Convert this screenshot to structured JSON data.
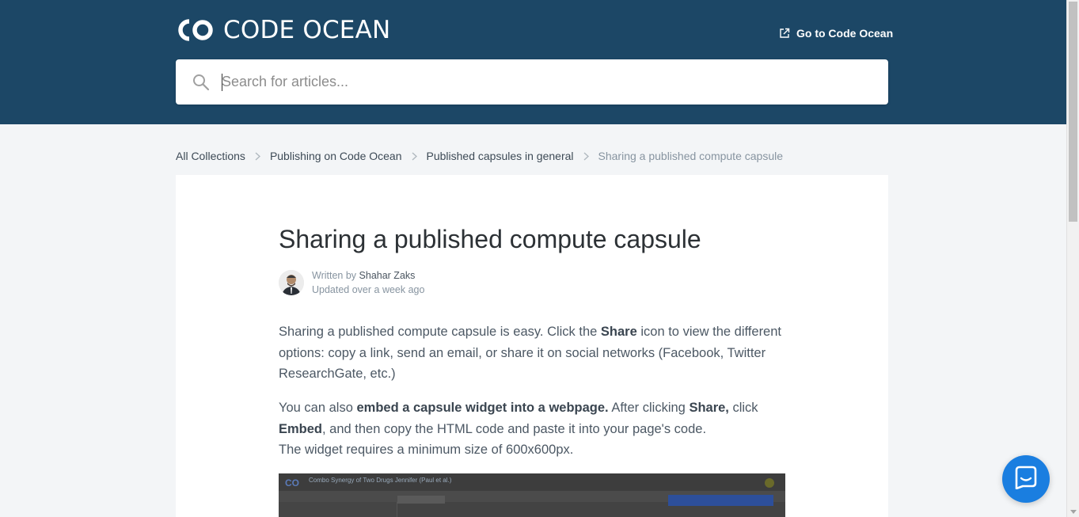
{
  "header": {
    "brand": "CODE OCEAN",
    "goto_label": "Go to Code Ocean",
    "search": {
      "placeholder": "Search for articles...",
      "value": ""
    }
  },
  "breadcrumb": [
    "All Collections",
    "Publishing on Code Ocean",
    "Published capsules in general",
    "Sharing a published compute capsule"
  ],
  "article": {
    "title": "Sharing a published compute capsule",
    "written_by_prefix": "Written by",
    "author": "Shahar Zaks",
    "updated": "Updated over a week ago",
    "p1": {
      "a": "Sharing a published compute capsule is easy. Click the ",
      "b": "Share",
      "c": " icon to view the different options: copy a link, send an email, or share it on social networks (Facebook, Twitter ResearchGate, etc.)"
    },
    "p2": {
      "a": "You can also ",
      "b": "embed a capsule widget into a webpage.",
      "c": " After clicking ",
      "d": "Share,",
      "e": " click ",
      "f": "Embed",
      "g": ", and then copy the HTML code and paste it into your page's code."
    },
    "p3": "The widget requires a minimum size of 600x600px."
  },
  "screenshot": {
    "capsule_title": "Combo Synergy of Two Drugs",
    "author_tag": "Jennifer (Paul et al.)"
  },
  "icons": {
    "search": "search-icon",
    "external_link": "external-link-icon",
    "chevron": "chevron-right-icon",
    "chat": "chat-icon"
  },
  "colors": {
    "header_bg": "#1c4766",
    "launcher": "#1a7ee0"
  }
}
